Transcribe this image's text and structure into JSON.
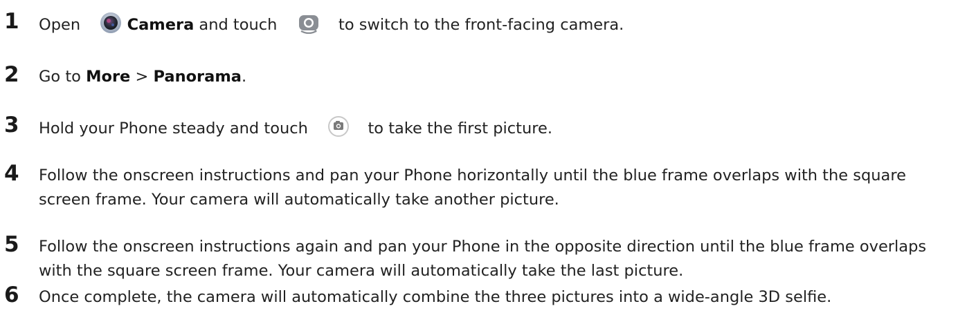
{
  "steps": [
    {
      "number": "1",
      "open": "Open",
      "camera_label": "Camera",
      "and_touch": "and touch",
      "after_icon": "to switch to the front-facing camera.",
      "camera_app_icon": "camera-app-icon",
      "switch_camera_icon": "switch-camera-icon"
    },
    {
      "number": "2",
      "go_to": "Go to",
      "more": "More",
      "separator": ">",
      "panorama": "Panorama",
      "period": "."
    },
    {
      "number": "3",
      "before_icon": "Hold your Phone steady and touch",
      "after_icon": "to take the first picture.",
      "shutter_icon": "shutter-icon"
    },
    {
      "number": "4",
      "text": "Follow the onscreen instructions and pan your Phone horizontally until the blue frame overlaps with the square screen frame. Your camera will automatically take another picture."
    },
    {
      "number": "5",
      "text": "Follow the onscreen instructions again and pan your Phone in the opposite direction until the blue frame overlaps with the square screen frame. Your camera will automatically take the last picture."
    },
    {
      "number": "6",
      "text": "Once complete, the camera will automatically combine the three pictures into a wide-angle 3D selfie."
    }
  ],
  "colors": {
    "text": "#222222",
    "number": "#1a1a1a",
    "camera_icon_ring": "#9aa7b8",
    "camera_icon_lens": "#2b2f3a",
    "camera_icon_accent": "#c04080",
    "switch_icon_gray": "#8a8e94",
    "shutter_icon_gray": "#9a9a9a"
  }
}
